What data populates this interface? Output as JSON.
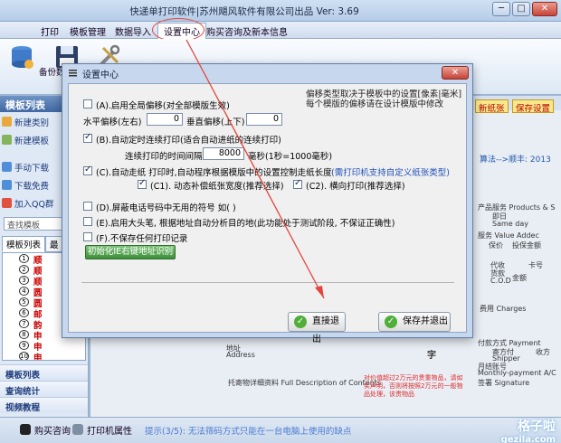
{
  "window": {
    "title": "快递单打印软件|苏州飓风软件有限公司出品  Ver: 3.69",
    "minimize": "─",
    "maximize": "□",
    "close": "✕"
  },
  "menu": {
    "items": [
      "打印",
      "模板管理",
      "数据导入",
      "设置中心",
      "购买咨询及新本信息"
    ]
  },
  "ribbon": {
    "buttons": [
      "备份数据库",
      "还"
    ]
  },
  "sidebar": {
    "header": "模板列表",
    "actions": [
      "新建类别",
      "新建模板",
      "手动下载",
      "下载免费",
      "加入QQ群"
    ],
    "search": "查找模板",
    "tabs": [
      "模板列表",
      "最"
    ],
    "rows": [
      {
        "num": "1",
        "label": "顺"
      },
      {
        "num": "2",
        "label": "顺"
      },
      {
        "num": "3",
        "label": "顺"
      },
      {
        "num": "4",
        "label": "圆"
      },
      {
        "num": "5",
        "label": "圆"
      },
      {
        "num": "6",
        "label": "邮"
      },
      {
        "num": "7",
        "label": "韵"
      },
      {
        "num": "8",
        "label": "申"
      },
      {
        "num": "9",
        "label": "申"
      },
      {
        "num": "10",
        "label": "申"
      }
    ],
    "sections": [
      "模板列表",
      "查询统计",
      "视频教程"
    ]
  },
  "background": {
    "buttons": [
      "新纸张",
      "保存设置"
    ],
    "algo": "算法-->顺丰: 2013",
    "labels": [
      "产品服务 Products & S",
      "即日",
      "Same day",
      "服务 Value Addec",
      "保价",
      "投保金额",
      "代收",
      "货款",
      "C.O.D",
      "卡号",
      "金额",
      "费用 Charges",
      "付款方式 Payment",
      "寄方付",
      "Shipper",
      "收方",
      "月结账号",
      "Monthly-payment A/C",
      "签署 Signature",
      "托寄物详细资料 Full Description of Contents",
      "地址",
      "Address",
      "字"
    ],
    "red_note": "对价值超过2万元的贵重物品，请如实声明，否则将按照2万元的一般物品处理，该贵物品"
  },
  "dialog": {
    "title": "设置中心",
    "close": "✕",
    "note_line1": "偏移类型取决于模板中的设置[像素|毫米]",
    "note_line2": "每个模版的偏移请在设计模版中修改",
    "opt_a": "(A).启用全局偏移(对全部模版生效)",
    "h_offset_label": "水平偏移(左右)",
    "h_offset_value": "0",
    "v_offset_label": "垂直偏移(上下)",
    "v_offset_value": "0",
    "opt_b": "(B).自动定时连续打印(适合自动进纸的连续打印)",
    "interval_label": "连续打印的时间间隔",
    "interval_value": "8000",
    "interval_unit": "毫秒(1秒=1000毫秒)",
    "opt_c": "(C).自动走纸    打印时,自动程序根据模版中的设置控制走纸长度",
    "opt_c_note": "(需打印机支持自定义纸张类型)",
    "opt_c1": "(C1). 动态补偿纸张宽度(推荐选择)",
    "opt_c2": "(C2). 横向打印(推荐选择)",
    "opt_d": "(D).屏蔽电话号码中无用的符号  如( )",
    "opt_e": "(E).启用大头笔, 根据地址自动分析目的地(此功能处于测试阶段, 不保证正确性)",
    "opt_f": "(F).不保存任何打印记录",
    "init_button": "初始化IE右键地址识别",
    "exit_button": "直接退出",
    "save_button": "保存并退出"
  },
  "status": {
    "buy": "购买咨询",
    "printer": "打印机属性",
    "tip": "提示(3/5): 无法筛码方式只能在一台电脑上使用的缺点"
  },
  "watermark": {
    "big": "格子啦",
    "small": "gezila.com"
  },
  "colors": {
    "accent": "#3f67a3",
    "dialog_bg": "#c7d8ee",
    "annotation_red": "#e2463c",
    "blue_note": "#1f4fb8",
    "green_button": "#3d8f3a"
  }
}
